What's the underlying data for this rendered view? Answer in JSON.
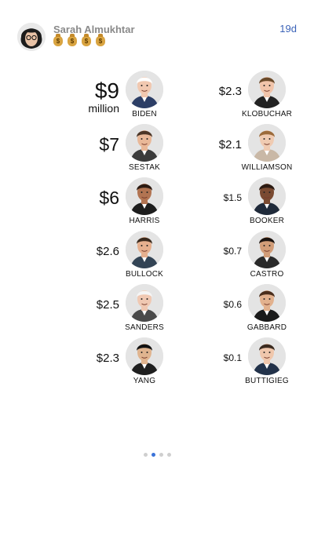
{
  "header": {
    "author": "Sarah Almukhtar",
    "badges": [
      "$",
      "$",
      "$",
      "$"
    ],
    "timestamp": "19d"
  },
  "candidates_left": [
    {
      "amount": "$9",
      "unit": "million",
      "name": "BIDEN",
      "skin": "#f1c8b0",
      "hair": "#ffffff",
      "suit": "#2c3e66"
    },
    {
      "amount": "$7",
      "unit": "",
      "name": "SESTAK",
      "skin": "#e9b898",
      "hair": "#4b3526",
      "suit": "#3b3b3b"
    },
    {
      "amount": "$6",
      "unit": "",
      "name": "HARRIS",
      "skin": "#b27452",
      "hair": "#2b1a12",
      "suit": "#1d1d1d"
    },
    {
      "amount": "$2.6",
      "unit": "",
      "name": "BULLOCK",
      "skin": "#e6b08f",
      "hair": "#3a2a1e",
      "suit": "#334455"
    },
    {
      "amount": "$2.5",
      "unit": "",
      "name": "SANDERS",
      "skin": "#f0c8b2",
      "hair": "#f5f5f5",
      "suit": "#4a4a4a"
    },
    {
      "amount": "$2.3",
      "unit": "",
      "name": "YANG",
      "skin": "#e0b48f",
      "hair": "#121212",
      "suit": "#1f1f1f"
    }
  ],
  "candidates_right": [
    {
      "amount": "$2.3",
      "name": "KLOBUCHAR",
      "skin": "#f1c4aa",
      "hair": "#6a4a2a",
      "suit": "#222222"
    },
    {
      "amount": "$2.1",
      "name": "WILLIAMSON",
      "skin": "#f0cbb2",
      "hair": "#9c6b3b",
      "suit": "#c9b8a6"
    },
    {
      "amount": "$1.5",
      "name": "BOOKER",
      "skin": "#7a4a31",
      "hair": "#2b1a12",
      "suit": "#1f2a3a"
    },
    {
      "amount": "$0.7",
      "name": "CASTRO",
      "skin": "#d29d78",
      "hair": "#1c1410",
      "suit": "#2a2a2a"
    },
    {
      "amount": "$0.6",
      "name": "GABBARD",
      "skin": "#e2b18e",
      "hair": "#4a2e1c",
      "suit": "#1a1a1a"
    },
    {
      "amount": "$0.1",
      "name": "BUTTIGIEG",
      "skin": "#f0c7ac",
      "hair": "#3a2a1f",
      "suit": "#22324a"
    }
  ],
  "pager": {
    "count": 4,
    "active_index": 1
  },
  "colors": {
    "accent": "#3b73d9",
    "author": "#8a8a8a",
    "timestamp": "#3b63b8"
  }
}
